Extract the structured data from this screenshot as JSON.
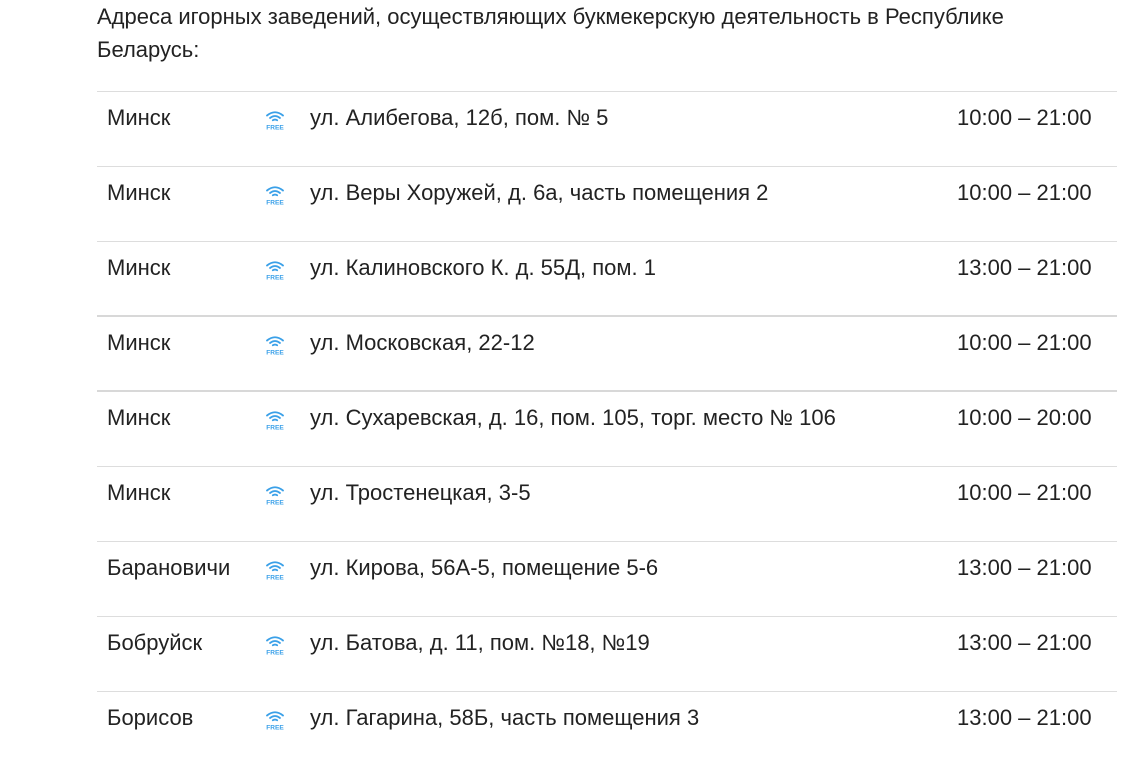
{
  "intro_text": "Адреса игорных заведений, осуществляющих букмекерскую деятельность в Республике Беларусь:",
  "icon": {
    "name": "wifi-free-icon",
    "label": "FREE",
    "color": "#3aa0e8"
  },
  "rows": [
    {
      "city": "Минск",
      "address": "ул. Алибегова, 12б, пом. № 5",
      "hours": "10:00 – 21:00"
    },
    {
      "city": "Минск",
      "address": "ул. Веры Хоружей, д. 6а, часть помещения 2",
      "hours": "10:00 – 21:00"
    },
    {
      "city": "Минск",
      "address": "ул. Калиновского К. д. 55Д, пом. 1",
      "hours": "13:00 – 21:00"
    },
    {
      "city": "Минск",
      "address": "ул. Московская, 22-12",
      "hours": "10:00 – 21:00"
    },
    {
      "city": "Минск",
      "address": "ул. Сухаревская, д. 16, пом. 105, торг. место № 106",
      "hours": "10:00 – 20:00"
    },
    {
      "city": "Минск",
      "address": "ул. Тростенецкая, 3-5",
      "hours": "10:00 – 21:00"
    },
    {
      "city": "Барановичи",
      "address": "ул. Кирова, 56А-5, помещение 5-6",
      "hours": "13:00 – 21:00"
    },
    {
      "city": "Бобруйск",
      "address": "ул. Батова, д. 11, пом. №18, №19",
      "hours": "13:00 – 21:00"
    },
    {
      "city": "Борисов",
      "address": "ул. Гагарина, 58Б, часть помещения 3",
      "hours": "13:00 – 21:00"
    }
  ]
}
